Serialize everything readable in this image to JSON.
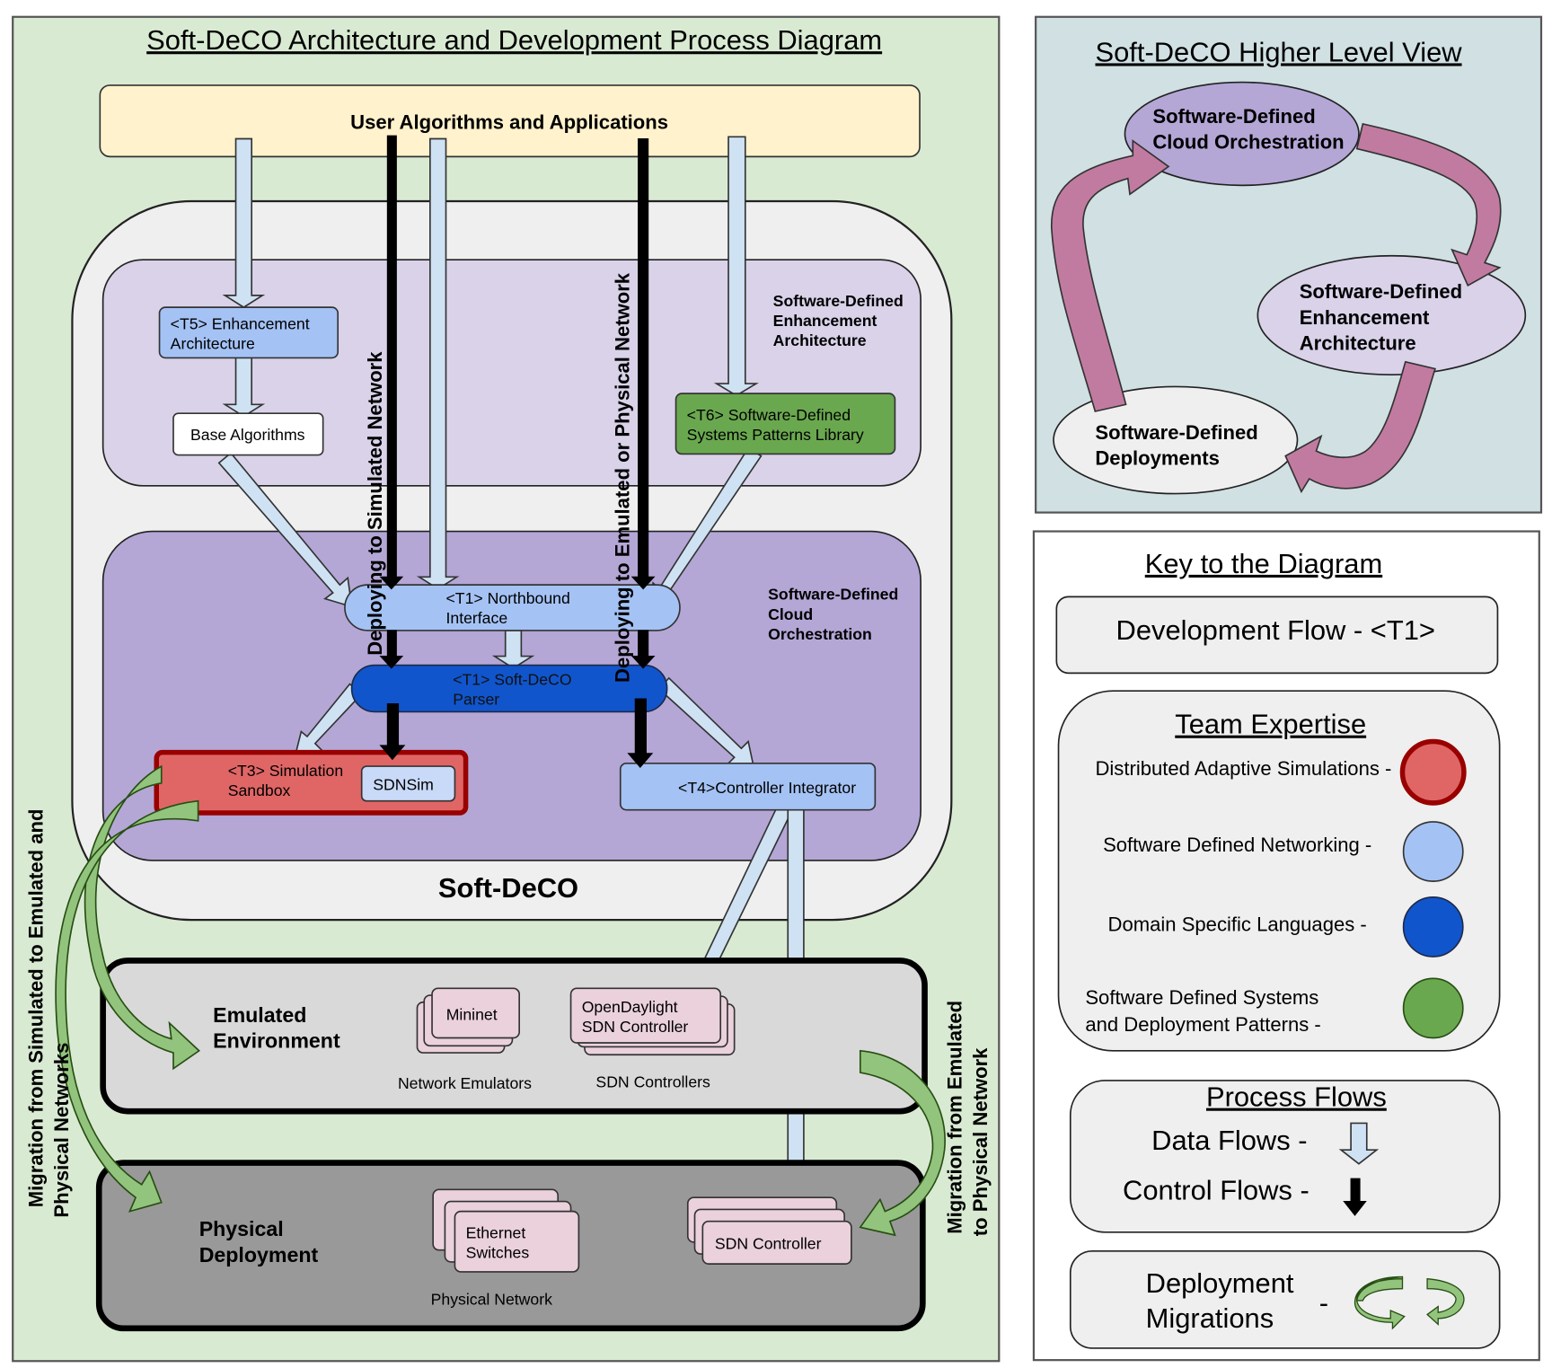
{
  "main": {
    "title": "Soft-DeCO Architecture and Development Process Diagram",
    "user_apps": "User Algorithms and Applications",
    "softdeco_label": "Soft-DeCO",
    "enhancement_region": [
      "Software-Defined",
      "Enhancement",
      "Architecture"
    ],
    "orchestration_region": [
      "Software-Defined",
      "Cloud",
      "Orchestration"
    ],
    "t5": [
      "<T5> Enhancement",
      "Architecture"
    ],
    "base_algorithms": "Base Algorithms",
    "t6": [
      "<T6> Software-Defined",
      "Systems Patterns Library"
    ],
    "t1_northbound": [
      "<T1> Northbound",
      "Interface"
    ],
    "t1_parser": [
      "<T1> Soft-DeCO",
      "Parser"
    ],
    "t3": [
      "<T3> Simulation",
      "Sandbox"
    ],
    "sdnsim": "SDNSim",
    "t4": "<T4>Controller Integrator",
    "deploy_sim": "Deploying to Simulated Network",
    "deploy_emu": "Deploying to Emulated or Physical Network",
    "emulated": [
      "Emulated",
      "Environment"
    ],
    "mininet": "Mininet",
    "opendaylight": [
      "OpenDaylight",
      "SDN Controller"
    ],
    "network_emulators": "Network Emulators",
    "sdn_controllers": "SDN Controllers",
    "physical": [
      "Physical",
      "Deployment"
    ],
    "ethernet": [
      "Ethernet",
      "Switches"
    ],
    "sdn_controller": "SDN Controller",
    "physical_network": "Physical Network",
    "migration_left": [
      "Migration from Simulated to Emulated and",
      "Physical Networks"
    ],
    "migration_right": [
      "Migration from Emulated",
      "to Physical Network"
    ]
  },
  "higher_level": {
    "title": "Soft-DeCO Higher Level View",
    "cloud": [
      "Software-Defined",
      "Cloud Orchestration"
    ],
    "enhancement": [
      "Software-Defined",
      "Enhancement",
      "Architecture"
    ],
    "deployments": [
      "Software-Defined",
      "Deployments"
    ]
  },
  "key": {
    "title": "Key to the Diagram",
    "dev_flow": "Development Flow -   <T1>",
    "team_title": "Team Expertise",
    "team": [
      {
        "label": "Distributed Adaptive Simulations -",
        "color": "#e06666",
        "stroke": "#990000"
      },
      {
        "label": "Software Defined Networking -",
        "color": "#a4c2f4",
        "stroke": "#333333"
      },
      {
        "label": "Domain Specific Languages -",
        "color": "#1155cc",
        "stroke": "#1c2a4a"
      },
      {
        "label": [
          "Software Defined Systems",
          "and Deployment Patterns -"
        ],
        "color": "#6aa84f",
        "stroke": "#274e13"
      }
    ],
    "process_title": "Process Flows",
    "data_flows": "Data Flows -",
    "control_flows": "Control Flows -",
    "migrations": [
      "Deployment",
      "Migrations"
    ],
    "migrations_dash": "-"
  },
  "colors": {
    "panel_green": "#d9ead3",
    "panel_teal": "#d0e0e3",
    "data_flow": "#cfe2f3",
    "control_flow": "#000000",
    "migration_arrow": "#93c47d",
    "cycle_arrow": "#c27ba0"
  }
}
